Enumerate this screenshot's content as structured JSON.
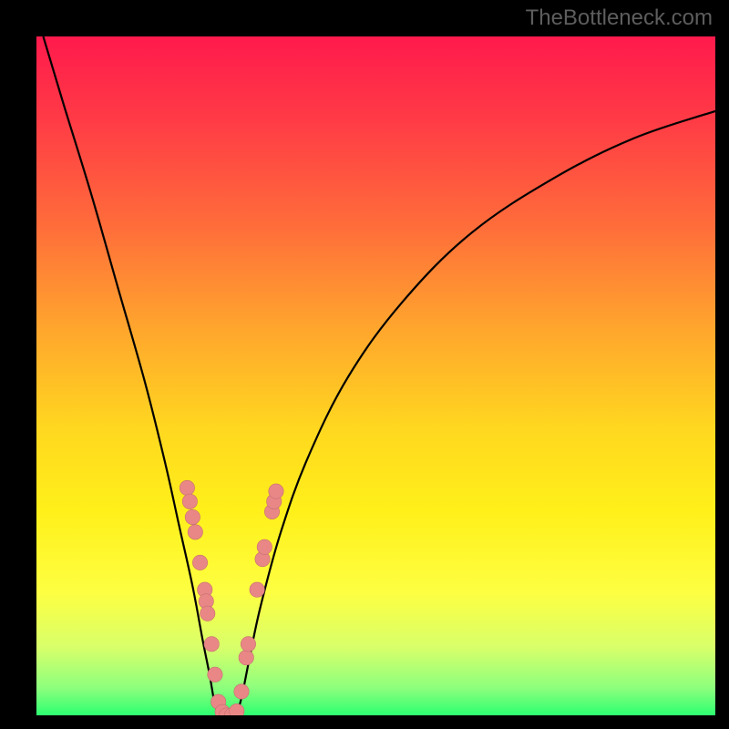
{
  "watermark": "TheBottleneck.com",
  "colors": {
    "gradient_stops": [
      {
        "offset": 0.0,
        "color": "#ff1a4c"
      },
      {
        "offset": 0.12,
        "color": "#ff3a46"
      },
      {
        "offset": 0.28,
        "color": "#ff6d3a"
      },
      {
        "offset": 0.42,
        "color": "#ffa22e"
      },
      {
        "offset": 0.58,
        "color": "#ffd81f"
      },
      {
        "offset": 0.7,
        "color": "#fff01a"
      },
      {
        "offset": 0.82,
        "color": "#fdff42"
      },
      {
        "offset": 0.9,
        "color": "#d8ff6a"
      },
      {
        "offset": 0.96,
        "color": "#8cff7d"
      },
      {
        "offset": 1.0,
        "color": "#2dff70"
      }
    ],
    "curve": "#000000",
    "dot_fill": "#e98787",
    "dot_stroke": "#c66f6f",
    "frame": "#000000"
  },
  "chart_data": {
    "type": "line",
    "title": "",
    "xlabel": "",
    "ylabel": "",
    "x_range": [
      0,
      100
    ],
    "y_range": [
      0,
      100
    ],
    "series": [
      {
        "name": "left-curve",
        "x": [
          1,
          4,
          8,
          12,
          16,
          19,
          21,
          23,
          24.5,
          25.5,
          26.2,
          26.8
        ],
        "y": [
          100,
          90,
          77,
          63,
          49,
          37,
          28,
          19,
          11,
          6,
          2,
          0
        ]
      },
      {
        "name": "right-curve",
        "x": [
          29.5,
          30.3,
          31.3,
          33,
          36,
          40,
          46,
          54,
          64,
          76,
          88,
          100
        ],
        "y": [
          0,
          3,
          8,
          16,
          27,
          38,
          50,
          61,
          71,
          79,
          85,
          89
        ]
      }
    ],
    "dots_left": [
      {
        "x": 22.2,
        "y": 33.5
      },
      {
        "x": 22.6,
        "y": 31.5
      },
      {
        "x": 23.0,
        "y": 29.2
      },
      {
        "x": 23.4,
        "y": 27.0
      },
      {
        "x": 24.1,
        "y": 22.5
      },
      {
        "x": 24.8,
        "y": 18.5
      },
      {
        "x": 25.0,
        "y": 16.8
      },
      {
        "x": 25.2,
        "y": 15.0
      },
      {
        "x": 25.8,
        "y": 10.5
      },
      {
        "x": 26.3,
        "y": 6.0
      },
      {
        "x": 26.8,
        "y": 2.0
      },
      {
        "x": 27.4,
        "y": 0.5
      },
      {
        "x": 28.0,
        "y": 0.0
      }
    ],
    "dots_right": [
      {
        "x": 28.8,
        "y": 0.0
      },
      {
        "x": 29.5,
        "y": 0.6
      },
      {
        "x": 30.2,
        "y": 3.5
      },
      {
        "x": 30.9,
        "y": 8.5
      },
      {
        "x": 31.2,
        "y": 10.5
      },
      {
        "x": 32.5,
        "y": 18.5
      },
      {
        "x": 33.3,
        "y": 23.0
      },
      {
        "x": 33.6,
        "y": 24.8
      },
      {
        "x": 34.7,
        "y": 30.0
      },
      {
        "x": 35.0,
        "y": 31.5
      },
      {
        "x": 35.3,
        "y": 33.0
      }
    ],
    "bottom_bar": {
      "y": 0.4,
      "color_key": "bottom"
    }
  }
}
